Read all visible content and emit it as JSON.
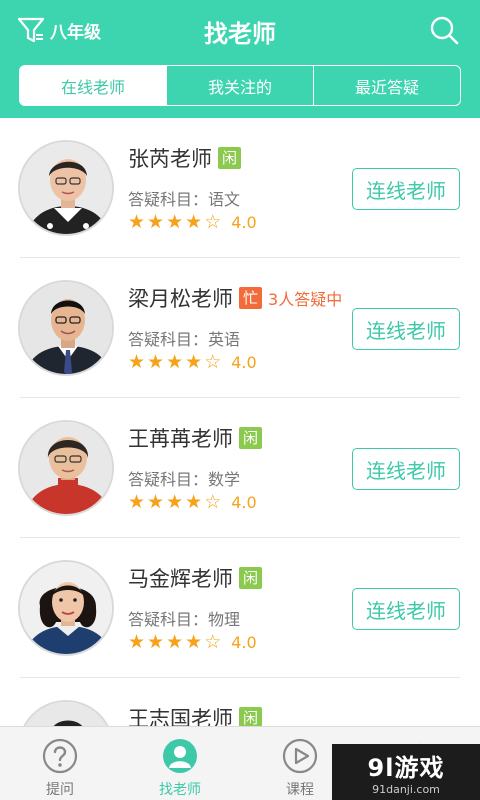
{
  "header": {
    "title": "找老师",
    "grade": "八年级",
    "filter_icon": "filter-icon",
    "search_icon": "search-icon",
    "color": "#3dd4b0"
  },
  "tabs": [
    {
      "label": "在线老师",
      "active": true
    },
    {
      "label": "我关注的",
      "active": false
    },
    {
      "label": "最近答疑",
      "active": false
    }
  ],
  "teachers": [
    {
      "name": "张芮老师",
      "status": "闲",
      "status_type": "idle",
      "queue": "",
      "subject": "答疑科目：语文",
      "stars": 4,
      "score": "4.0",
      "button": "连线老师"
    },
    {
      "name": "梁月松老师",
      "status": "忙",
      "status_type": "busy",
      "queue": "3人答疑中",
      "subject": "答疑科目：英语",
      "stars": 4,
      "score": "4.0",
      "button": "连线老师"
    },
    {
      "name": "王苒苒老师",
      "status": "闲",
      "status_type": "idle",
      "queue": "",
      "subject": "答疑科目：数学",
      "stars": 4,
      "score": "4.0",
      "button": "连线老师"
    },
    {
      "name": "马金辉老师",
      "status": "闲",
      "status_type": "idle",
      "queue": "",
      "subject": "答疑科目：物理",
      "stars": 4,
      "score": "4.0",
      "button": "连线老师"
    },
    {
      "name": "王志国老师",
      "status": "闲",
      "status_type": "idle",
      "queue": "",
      "subject": "",
      "stars": 0,
      "score": "",
      "button": ""
    }
  ],
  "bottom_nav": [
    {
      "label": "提问",
      "icon": "question-icon",
      "active": false
    },
    {
      "label": "找老师",
      "icon": "teacher-icon",
      "active": true
    },
    {
      "label": "课程",
      "icon": "play-icon",
      "active": false
    },
    {
      "label": "",
      "icon": "profile-icon",
      "active": false
    }
  ],
  "watermark": {
    "main": "9l游戏",
    "sub": "91danji.com"
  },
  "colors": {
    "accent": "#3dc9a8",
    "idle": "#8cc94f",
    "busy": "#f26b3a",
    "star": "#f7a21b"
  }
}
